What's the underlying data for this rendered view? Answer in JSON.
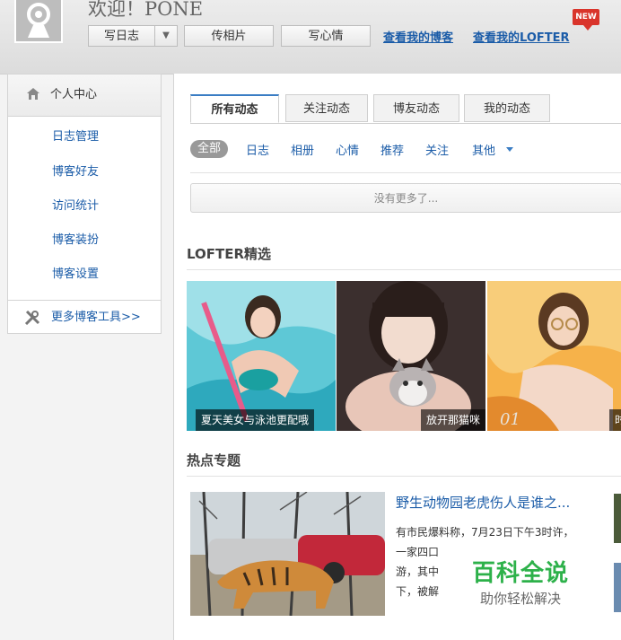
{
  "header": {
    "welcome": "欢迎！PONE",
    "buttons": {
      "write_log": "写日志",
      "upload_photo": "传相片",
      "write_mood": "写心情"
    },
    "links": {
      "my_blog": "查看我的博客",
      "my_lofter": "查看我的LOFTER"
    },
    "new_badge": "NEW"
  },
  "sidebar": {
    "title": "个人中心",
    "items": [
      "日志管理",
      "博客好友",
      "访问统计",
      "博客装扮",
      "博客设置"
    ],
    "more_tools": "更多博客工具>>"
  },
  "feed": {
    "tabs": [
      "所有动态",
      "关注动态",
      "博友动态",
      "我的动态"
    ],
    "filters": [
      "全部",
      "日志",
      "相册",
      "心情",
      "推荐",
      "关注",
      "其他"
    ],
    "no_more": "没有更多了..."
  },
  "lofter": {
    "title": "LOFTER精选",
    "pictures": [
      {
        "caption": "夏天美女与泳池更配哦"
      },
      {
        "caption": "放开那猫咪"
      },
      {
        "caption": "时"
      }
    ]
  },
  "hot": {
    "title": "热点专题",
    "topic": {
      "title": "野生动物园老虎伤人是谁之...",
      "lines": [
        "有市民爆料称，7月23日下午3时许，",
        "一家四口",
        "游，其中",
        "下，被解"
      ]
    }
  },
  "watermark": {
    "brand": "百科全说",
    "slogan": "助你轻松解决"
  },
  "colors": {
    "link": "#1b5ca8",
    "accent": "#3a7dc4",
    "badge": "#d9342b",
    "watermark": "#2db14a"
  }
}
